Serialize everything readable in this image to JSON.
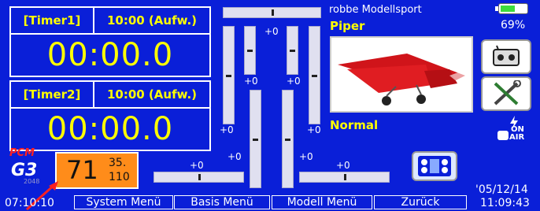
{
  "timer1": {
    "label": "[Timer1]",
    "mode": "10:00 (Aufw.)",
    "value": "00:00.0"
  },
  "timer2": {
    "label": "[Timer2]",
    "mode": "10:00 (Aufw.)",
    "value": "00:00.0"
  },
  "status": {
    "modulation": "PCM",
    "g3_text": "G3",
    "g3_sub": "2048",
    "rx_number": "71",
    "channel_top": "35.",
    "channel_bottom": "110"
  },
  "model": {
    "brand": "robbe Modellsport",
    "name": "Piper",
    "flight_mode": "Normal"
  },
  "battery": {
    "percent": "69%",
    "level": 0.69
  },
  "trims": {
    "top_left": "+0",
    "middle_left": "+0",
    "middle_right": "+0",
    "mid_left_low": "+0",
    "right_low": "+0",
    "bottom_left_center": "+0",
    "bottom_center_left": "+0",
    "bottom_center_right": "+0",
    "bottom_right": "+0"
  },
  "icons": {
    "on_air_line1": "ON",
    "on_air_line2": "AIR"
  },
  "footer": {
    "time_left": "07:10:10",
    "menus": [
      "System Menü",
      "Basis Menü",
      "Modell Menü",
      "Zurück"
    ],
    "date": "'05/12/14",
    "time": "11:09:43"
  },
  "colors": {
    "background": "#0a1fd8",
    "accent_yellow": "#ffff00",
    "status_orange": "#ff8c1a",
    "pcm_red": "#ff0000"
  }
}
